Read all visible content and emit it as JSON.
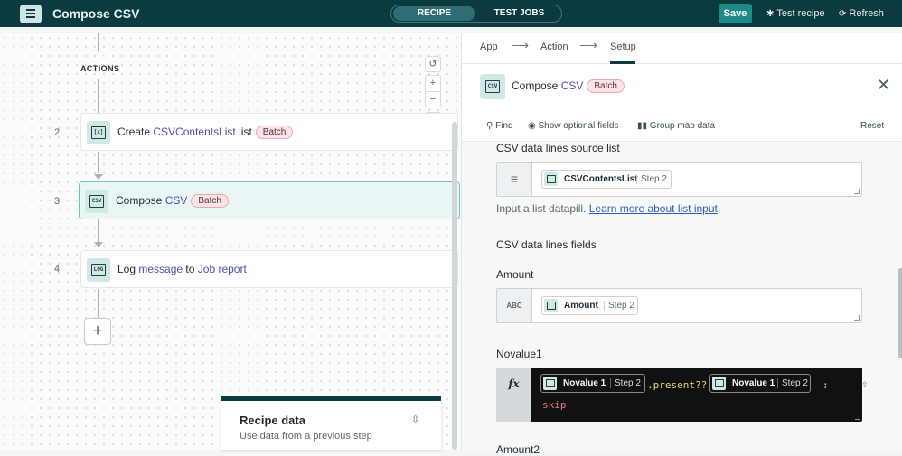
{
  "header": {
    "title": "Compose CSV",
    "tabs": [
      "RECIPE",
      "TEST JOBS"
    ],
    "save_label": "Save",
    "test_recipe_label": "Test recipe",
    "refresh_label": "Refresh"
  },
  "canvas": {
    "actions_label": "ACTIONS",
    "steps": [
      {
        "number": "2",
        "verb": "Create",
        "object": "CSVContentsList",
        "suffix": "list",
        "badge": "Batch"
      },
      {
        "number": "3",
        "verb": "Compose",
        "object": "CSV",
        "badge": "Batch"
      },
      {
        "number": "4",
        "verb": "Log",
        "object": "message",
        "middle": "to",
        "target": "Job report"
      }
    ],
    "add_step": "+",
    "recipe_data": {
      "title": "Recipe data",
      "subtitle": "Use data from a previous step"
    }
  },
  "panel": {
    "breadcrumb": [
      "App",
      "Action",
      "Setup"
    ],
    "title_prefix": "Compose",
    "title_object": "CSV",
    "title_badge": "Batch",
    "toolbar": {
      "find": "Find",
      "optional": "Show optional fields",
      "group": "Group map data",
      "reset": "Reset"
    },
    "fields": {
      "source_list": {
        "label": "CSV data lines source list",
        "pill_name": "CSVContentsList",
        "pill_step": "Step 2",
        "help": "Input a list datapill.",
        "help_link": "Learn more about list input"
      },
      "lines_fields_label": "CSV data lines fields",
      "amount": {
        "label": "Amount",
        "prefix": "ABC",
        "pill_name": "Amount",
        "pill_step": "Step 2"
      },
      "novalue1": {
        "label": "Novalue1",
        "prefix": "fx",
        "pill1_name": "Novalue 1",
        "pill1_step": "Step 2",
        "code1": ".present??",
        "pill2_name": "Novalue 1",
        "pill2_step": "Step 2",
        "code2": ":",
        "code3": "skip"
      },
      "amount2_label": "Amount2"
    }
  }
}
